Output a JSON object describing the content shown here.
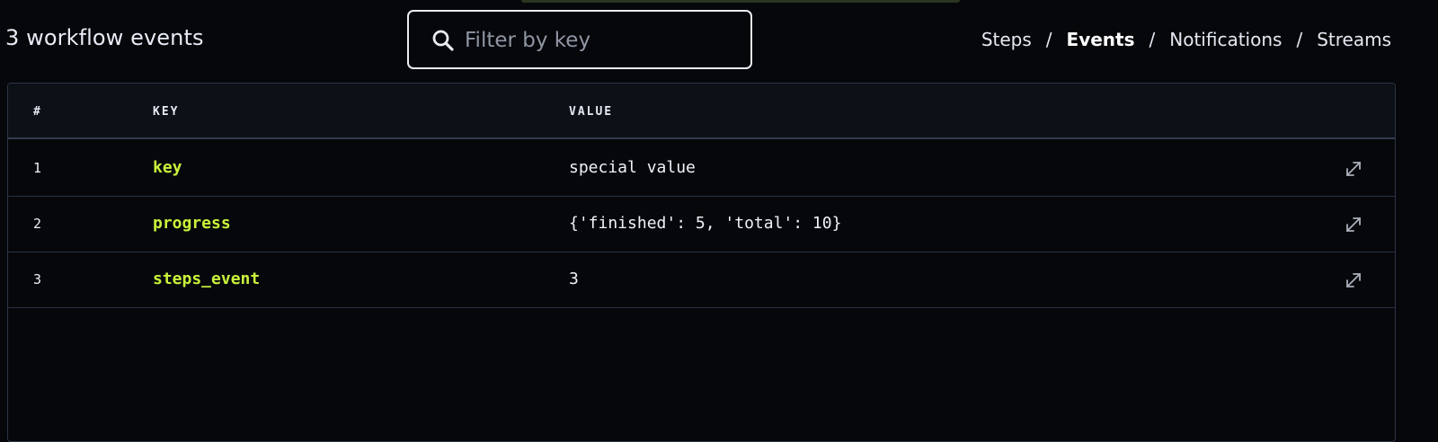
{
  "header": {
    "count_title": "3 workflow events",
    "search": {
      "placeholder": "Filter by key",
      "value": ""
    },
    "nav": [
      {
        "label": "Steps",
        "active": false
      },
      {
        "label": "Events",
        "active": true
      },
      {
        "label": "Notifications",
        "active": false
      },
      {
        "label": "Streams",
        "active": false
      }
    ],
    "nav_separator": "/"
  },
  "table": {
    "columns": [
      "#",
      "KEY",
      "VALUE"
    ],
    "rows": [
      {
        "index": "1",
        "key": "key",
        "value": "special value"
      },
      {
        "index": "2",
        "key": "progress",
        "value": "{'finished': 5, 'total': 10}"
      },
      {
        "index": "3",
        "key": "steps_event",
        "value": "3"
      }
    ]
  },
  "icons": {
    "search": "search-icon",
    "expand": "expand-icon"
  },
  "colors": {
    "background": "#06070b",
    "header_bg": "#0c1017",
    "key_accent": "#c9f23b",
    "border": "#2c3646"
  }
}
